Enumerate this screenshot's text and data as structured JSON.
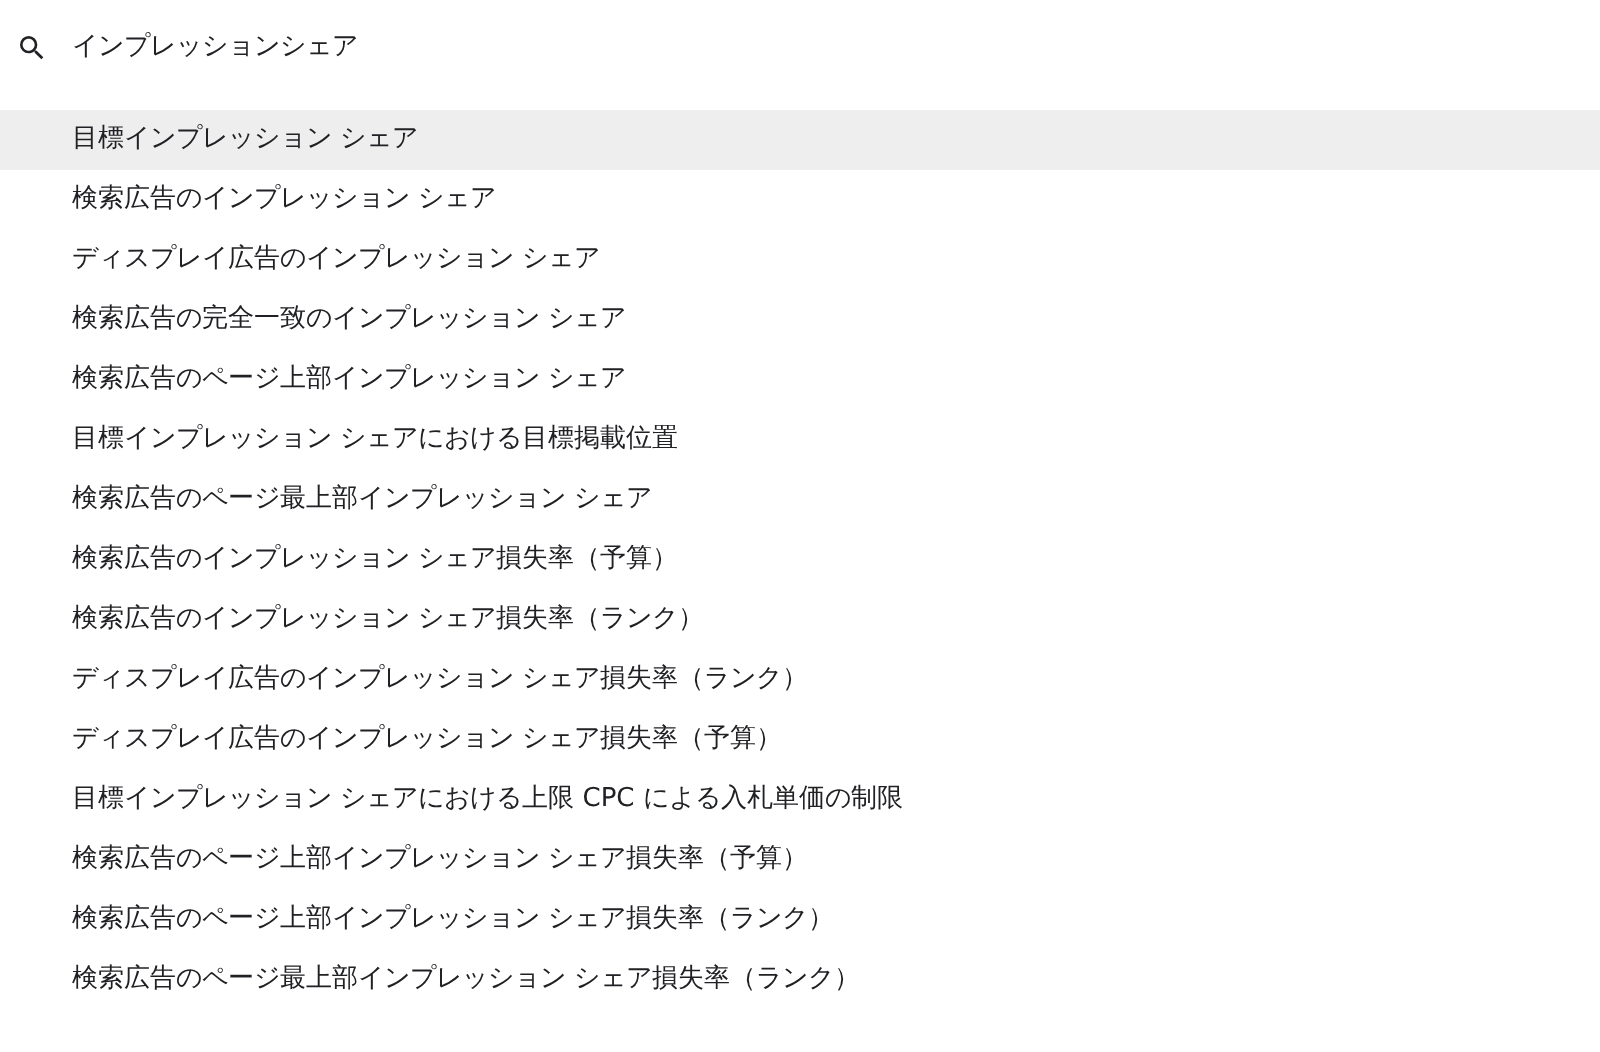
{
  "search": {
    "value": "インプレッションシェア"
  },
  "results": [
    {
      "label": "目標インプレッション シェア",
      "selected": true
    },
    {
      "label": "検索広告のインプレッション シェア",
      "selected": false
    },
    {
      "label": "ディスプレイ広告のインプレッション シェア",
      "selected": false
    },
    {
      "label": "検索広告の完全一致のインプレッション シェア",
      "selected": false
    },
    {
      "label": "検索広告のページ上部インプレッション シェア",
      "selected": false
    },
    {
      "label": "目標インプレッション シェアにおける目標掲載位置",
      "selected": false
    },
    {
      "label": "検索広告のページ最上部インプレッション シェア",
      "selected": false
    },
    {
      "label": "検索広告のインプレッション シェア損失率（予算）",
      "selected": false
    },
    {
      "label": "検索広告のインプレッション シェア損失率（ランク）",
      "selected": false
    },
    {
      "label": "ディスプレイ広告のインプレッション シェア損失率（ランク）",
      "selected": false
    },
    {
      "label": "ディスプレイ広告のインプレッション シェア損失率（予算）",
      "selected": false
    },
    {
      "label": "目標インプレッション シェアにおける上限 CPC による入札単価の制限",
      "selected": false
    },
    {
      "label": "検索広告のページ上部インプレッション シェア損失率（予算）",
      "selected": false
    },
    {
      "label": "検索広告のページ上部インプレッション シェア損失率（ランク）",
      "selected": false
    },
    {
      "label": "検索広告のページ最上部インプレッション シェア損失率（ランク）",
      "selected": false
    }
  ]
}
